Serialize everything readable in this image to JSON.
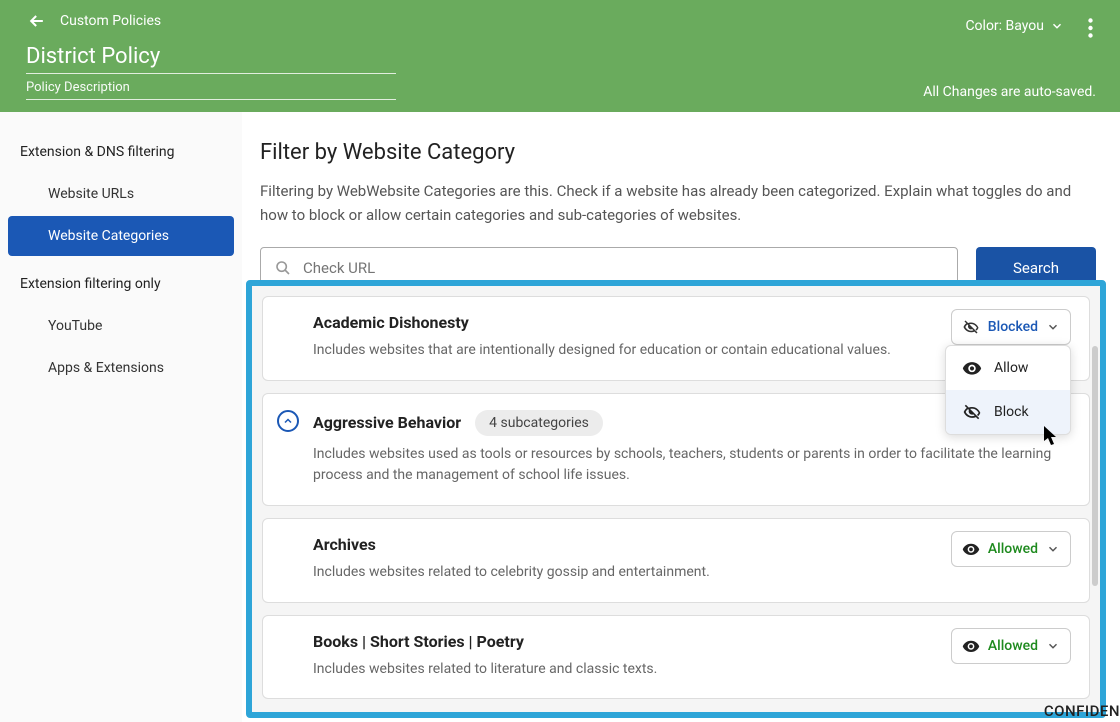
{
  "header": {
    "breadcrumb": "Custom Policies",
    "title": "District Policy",
    "title_placeholder": "District Policy",
    "description_placeholder": "Policy Description",
    "color_label": "Color: Bayou",
    "autosave": "All Changes are auto-saved."
  },
  "sidebar": {
    "section1": "Extension & DNS filtering",
    "items1": [
      "Website URLs",
      "Website Categories"
    ],
    "active_index": 1,
    "section2": "Extension filtering only",
    "items2": [
      "YouTube",
      "Apps & Extensions"
    ]
  },
  "main": {
    "heading": "Filter by Website Category",
    "subtitle": "Filtering by WebWebsite Categories are this. Check if a website has already been categorized. Explain what toggles do and how to block or allow certain categories and sub-categories of websites.",
    "search_placeholder": "Check URL",
    "search_button": "Search"
  },
  "categories": [
    {
      "title": "Academic Dishonesty",
      "description": "Includes websites that are intentionally designed for education or contain educational values.",
      "status": "Blocked",
      "status_type": "blocked",
      "dropdown_open": true,
      "expandable": false
    },
    {
      "title": "Aggressive Behavior",
      "badge": "4 subcategories",
      "description": "Includes websites used as tools or resources by schools, teachers, students or parents in order to facilitate the learning process and the management of school life issues.",
      "status": "",
      "expandable": true
    },
    {
      "title": "Archives",
      "description": "Includes websites related to celebrity gossip and entertainment.",
      "status": "Allowed",
      "status_type": "allowed",
      "expandable": false
    },
    {
      "title": "Books | Short Stories | Poetry",
      "description": "Includes websites related to literature and classic texts.",
      "status": "Allowed",
      "status_type": "allowed",
      "expandable": false
    }
  ],
  "dropdown_menu": {
    "allow": "Allow",
    "block": "Block"
  },
  "watermark": "CONFIDEN"
}
